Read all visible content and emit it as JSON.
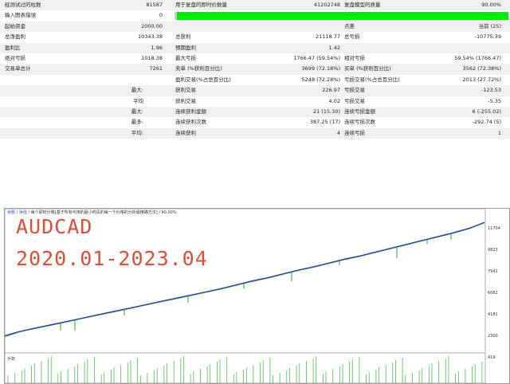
{
  "report": {
    "rows": [
      {
        "l1": "经测试过的柱数",
        "v1": "81587",
        "l2": "用于复盘的即时价数量",
        "v2": "41202748",
        "l3": "复盘模型的质量",
        "v3": "90.00%"
      },
      {
        "l1": "输入图表错误",
        "v1": "0",
        "quality_percent": 90
      },
      {
        "l1": "起始资金",
        "v1": "2000.00",
        "l3": "点差",
        "v3": "当前 (25)"
      },
      {
        "l1": "总净盈利",
        "v1": "10343.38",
        "l2": "总获利",
        "v2": "21118.77",
        "l3": "总亏损",
        "v3": "-10775.39"
      },
      {
        "l1": "盈利比",
        "v1": "1.96",
        "l2": "预期盈利",
        "v2": "1.42"
      },
      {
        "l1": "绝对亏损",
        "v1": "1018.38",
        "l2": "最大亏损",
        "v2": "1766.47 (59.54%)",
        "l3": "相对亏损",
        "v3": "59.54% (1766.47)"
      },
      {
        "l1": "交易单总计",
        "v1": "7261",
        "l2": "卖单 (%获利百分比)",
        "v2": "3699 (72.18%)",
        "l3": "买单 (%获利百分比)",
        "v3": "3562 (72.38%)"
      },
      {
        "l2": "盈利交易(%占总百分比)",
        "v2": "5248 (72.28%)",
        "l3": "亏损交易(%占总百分比)",
        "v3": "2013 (27.72%)"
      },
      {
        "lbr": "最大:",
        "l2": "获利交易",
        "v2": "226.97",
        "l3": "亏损交易",
        "v3": "-123.53"
      },
      {
        "lbr": "平均",
        "l2": "获利交易",
        "v2": "4.02",
        "l3": "亏损交易",
        "v3": "-5.35"
      },
      {
        "lbr": "最大:",
        "l2": "连续获利金额",
        "v2": "21 (15.30)",
        "l3": "连续亏损金额",
        "v3": "6 (-255.02)"
      },
      {
        "lbr": "最多:",
        "l2": "连续获利次数",
        "v2": "387.25 (17)",
        "l3": "连续亏损次数",
        "v3": "-292.74 (5)"
      },
      {
        "lbr": "平均:",
        "l2": "连续获利",
        "v2": "4",
        "l3": "连续亏损",
        "v3": "1"
      }
    ]
  },
  "chart_panel": {
    "title_link1": "余额",
    "title_sep1": " / ",
    "title_link2": "净值",
    "title_rest": " / 每个即时价格[基于所有可用的最小时段的每一个价格的分析最精确方法] / 90.00%",
    "watermark_line1": "AUDCAD",
    "watermark_line2": "2020.01-2023.04",
    "volume_label": "手数",
    "colors": {
      "balance": "#2a3bb8",
      "equity": "#2e9e2e",
      "volume": "#4fbf4f",
      "watermark": "#e24c36",
      "quality_bar": "#00ee00"
    }
  },
  "chart_data": {
    "type": "line",
    "yticks": [
      "11704",
      "9823",
      "7942",
      "6062",
      "4181",
      "2300",
      "419"
    ],
    "ylim": [
      419,
      13000
    ],
    "series": [
      {
        "values": [
          2000,
          2400,
          2700,
          3000,
          3300,
          3600,
          3900,
          4200,
          4500,
          4800,
          5100,
          5400,
          5700,
          6000,
          6300,
          6650,
          7000,
          7300,
          7650,
          8000,
          8300,
          8650,
          9000,
          9300,
          9650,
          10000,
          10350,
          10700,
          11050,
          11400,
          11800,
          12344
        ]
      },
      {
        "values": [
          1900,
          2350,
          2650,
          2950,
          3250,
          3550,
          3850,
          4150,
          4450,
          4750,
          5050,
          5350,
          5650,
          5950,
          6250,
          6600,
          6950,
          7250,
          7600,
          7950,
          8250,
          8600,
          8950,
          9250,
          9600,
          9950,
          10300,
          10650,
          11000,
          11350,
          11750,
          12300
        ]
      }
    ]
  }
}
